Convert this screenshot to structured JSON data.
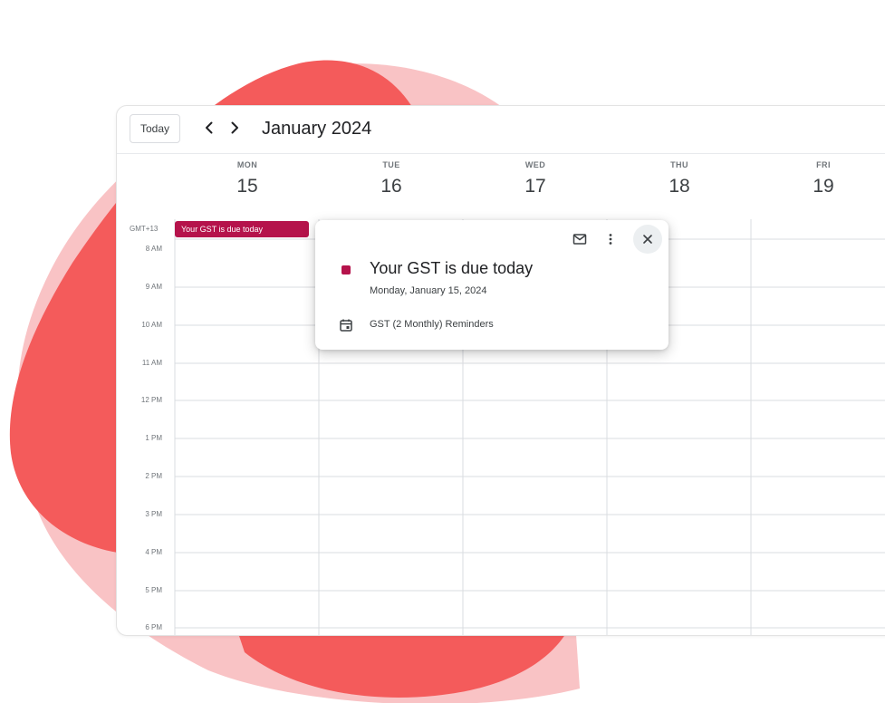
{
  "toolbar": {
    "today_label": "Today",
    "prev_icon": "chevron-left-icon",
    "next_icon": "chevron-right-icon",
    "month_title": "January 2024"
  },
  "days": [
    {
      "name": "MON",
      "num": "15"
    },
    {
      "name": "TUE",
      "num": "16"
    },
    {
      "name": "WED",
      "num": "17"
    },
    {
      "name": "THU",
      "num": "18"
    },
    {
      "name": "FRI",
      "num": "19"
    }
  ],
  "timezone": "GMT+13",
  "hours": [
    "8 AM",
    "9 AM",
    "10 AM",
    "11 AM",
    "12 PM",
    "1 PM",
    "2 PM",
    "3 PM",
    "4 PM",
    "5 PM",
    "6 PM"
  ],
  "all_day_event": {
    "title": "Your GST is due today",
    "color": "#b5134b"
  },
  "popup": {
    "title": "Your GST is due today",
    "date": "Monday, January 15, 2024",
    "calendar_name": "GST (2 Monthly) Reminders",
    "email_icon": "email-icon",
    "more_icon": "more-vert-icon",
    "close_icon": "close-icon",
    "calendar_icon": "calendar-icon"
  },
  "colors": {
    "event": "#b5134b",
    "blob_primary": "#f45b5b",
    "blob_light": "#f9c3c5"
  }
}
